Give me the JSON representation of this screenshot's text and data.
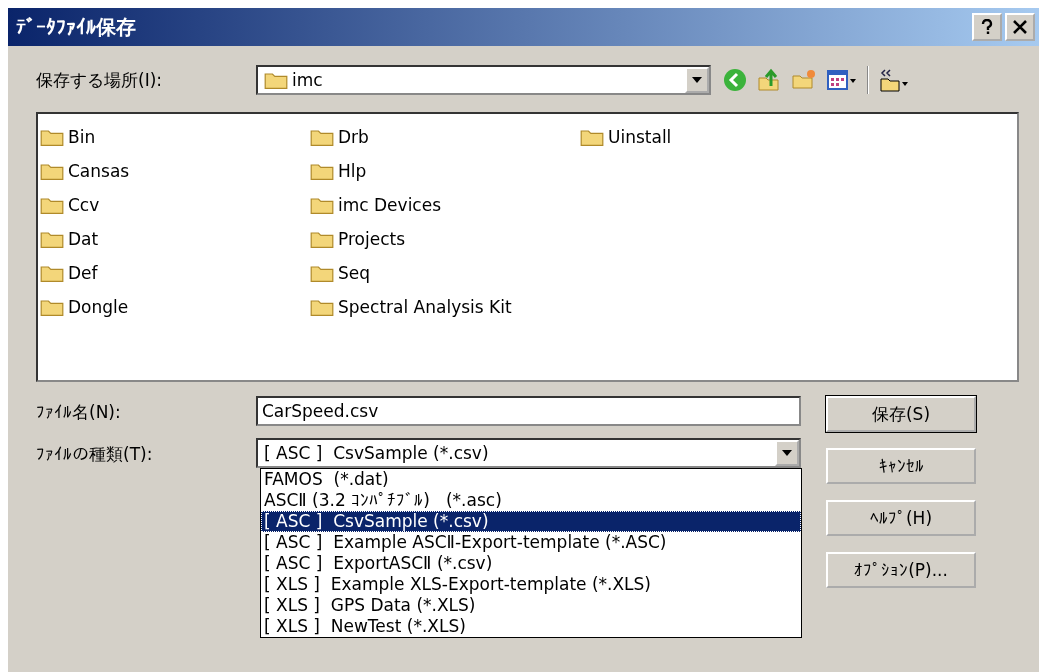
{
  "window": {
    "title": "ﾃﾞｰﾀﾌｧｲﾙ保存"
  },
  "location": {
    "label": "保存する場所(I):",
    "value": "imc"
  },
  "folders": [
    {
      "name": "Bin"
    },
    {
      "name": "Cansas"
    },
    {
      "name": "Ccv"
    },
    {
      "name": "Dat"
    },
    {
      "name": "Def"
    },
    {
      "name": "Dongle"
    },
    {
      "name": "Drb"
    },
    {
      "name": "Hlp"
    },
    {
      "name": "imc Devices"
    },
    {
      "name": "Projects"
    },
    {
      "name": "Seq"
    },
    {
      "name": "Spectral Analysis Kit"
    },
    {
      "name": "Uinstall"
    }
  ],
  "file_name": {
    "label": "ﾌｧｲﾙ名(N):",
    "value": "CarSpeed.csv"
  },
  "file_type": {
    "label": "ﾌｧｲﾙの種類(T):",
    "value": "[ ASC ]  CsvSample (*.csv)",
    "expanded": true,
    "options": [
      {
        "label": "FAMOS  (*.dat)",
        "selected": false
      },
      {
        "label": "ASCⅡ (3.2 ｺﾝﾊﾟﾁﾌﾞﾙ)   (*.asc)",
        "selected": false
      },
      {
        "label": "[ ASC ]  CsvSample (*.csv)",
        "selected": true
      },
      {
        "label": "[ ASC ]  Example ASCⅡ-Export-template (*.ASC)",
        "selected": false
      },
      {
        "label": "[ ASC ]  ExportASCⅡ (*.csv)",
        "selected": false
      },
      {
        "label": "[ XLS ]  Example XLS-Export-template (*.XLS)",
        "selected": false
      },
      {
        "label": "[ XLS ]  GPS Data (*.XLS)",
        "selected": false
      },
      {
        "label": "[ XLS ]  NewTest (*.XLS)",
        "selected": false
      }
    ]
  },
  "buttons": [
    {
      "label": "保存(S)",
      "default": true
    },
    {
      "label": "ｷｬﾝｾﾙ",
      "default": false
    },
    {
      "label": "ﾍﾙﾌﾟ(H)",
      "default": false
    },
    {
      "label": "ｵﾌﾟｼｮﾝ(P)...",
      "default": false
    }
  ]
}
